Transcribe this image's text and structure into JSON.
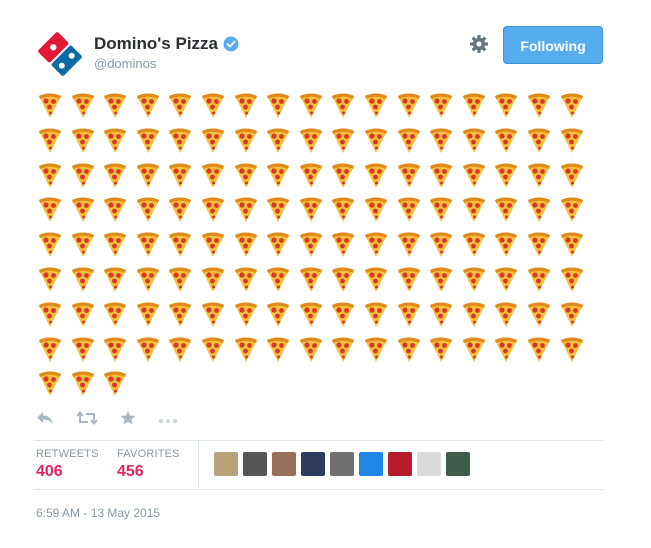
{
  "tweet": {
    "display_name": "Domino's Pizza",
    "handle": "@dominos",
    "follow_button_label": "Following",
    "emoji_name": "pizza-icon",
    "emoji_count": 139,
    "emoji_rows": [
      17,
      17,
      17,
      17,
      17,
      17,
      17,
      17,
      3
    ],
    "timestamp": "6:59 AM - 13 May 2015"
  },
  "stats": {
    "retweets_label": "RETWEETS",
    "retweets_value": "406",
    "favorites_label": "FAVORITES",
    "favorites_value": "456"
  },
  "actions": [
    "reply-icon",
    "retweet-icon",
    "favorite-icon",
    "more-icon"
  ],
  "favoriter_avatars": [
    "#b9a17a",
    "#565656",
    "#9a6e5a",
    "#2e3b5a",
    "#707070",
    "#1e88e5",
    "#b71c2c",
    "#dcdcdc",
    "#3e5c4a"
  ],
  "colors": {
    "accent": "#55acee",
    "stat_value": "#e0245e",
    "muted": "#8899a6",
    "domino_blue": "#0b6ba3",
    "domino_red": "#e31837"
  }
}
